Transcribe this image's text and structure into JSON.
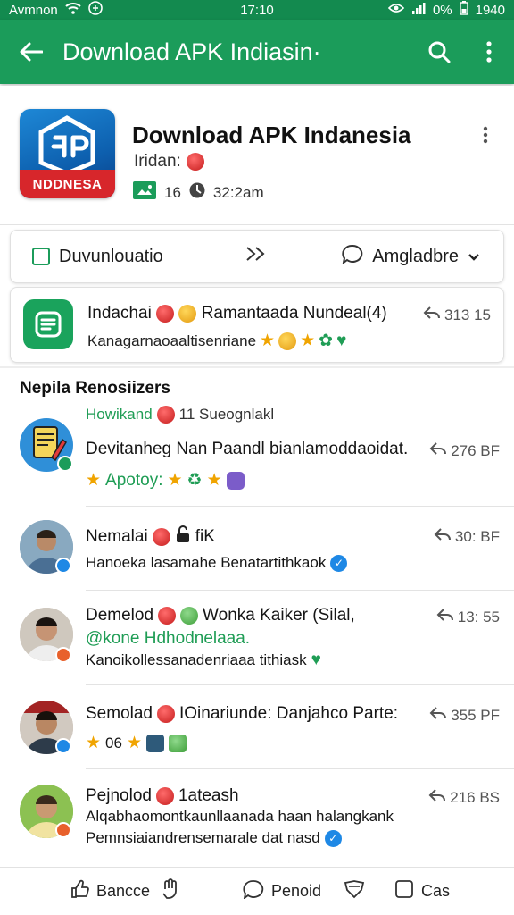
{
  "statusbar": {
    "carrier": "Avmnon",
    "time": "17:10",
    "battery_pct": "0%",
    "clock_right": "1940"
  },
  "appbar": {
    "title": "Download APK Indiasin·"
  },
  "app": {
    "name": "Download APK Indanesia",
    "icon_banner": "NDDNESA",
    "subtitle": "Iridan:",
    "count": "16",
    "time": "32:2am"
  },
  "actions": {
    "download_label": "Duvunlouatio",
    "lang_label": "Amgladbre"
  },
  "pinned": {
    "title": "Indachai",
    "title_rest": "Ramantaada Nundeal(4)",
    "subtitle": "Kanagarnaoaaltisenriane",
    "time": "313 15"
  },
  "section": {
    "title": "Nepila Renosiizers"
  },
  "items": [
    {
      "top_label": "Howikand",
      "top_rest": "11 Sueognlakl",
      "text": "Devitanheg Nan Paandl bianlamoddaoidat.",
      "sub": "Apotoy:",
      "time": "276 BF"
    },
    {
      "name": "Nemalai",
      "tag": "fiK",
      "text": "Hanoeka lasamahe Benatartithkaok",
      "time": "30: BF"
    },
    {
      "name": "Demelod",
      "rest": "Wonka Kaiker (Silal,",
      "green": "@kone Hdhodnelaaa.",
      "text": "Kanoikollessanadenriaaa tithiask",
      "time": "13: 55"
    },
    {
      "name": "Semolad",
      "rest": "IOinariunde: Danjahco Parte:",
      "sub": "06",
      "time": "355 PF"
    },
    {
      "name": "Pejnolod",
      "rest": "1ateash",
      "text": "Alqabhaomontkaunllaanada haan halangkank",
      "text2": "Pemnsiaiandrensemarale dat nasd",
      "time": "216 BS"
    }
  ],
  "bottom": {
    "b1": "Bancce",
    "b2": "Penoid",
    "b3": "Cas"
  },
  "colors": {
    "primary": "#1b9c5a",
    "status": "#138a4f",
    "star": "#f0a400"
  }
}
